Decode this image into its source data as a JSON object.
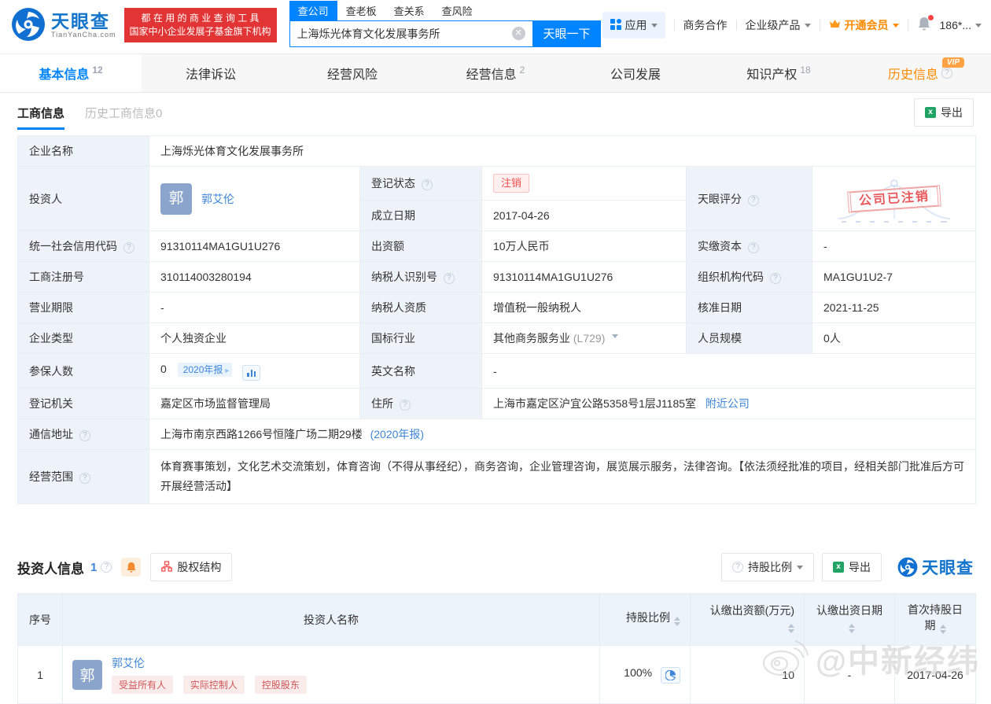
{
  "header": {
    "logo": {
      "name": "天眼查",
      "domain": "TianYanCha.com"
    },
    "promo": {
      "line1": "都 在 用 的 商 业 查 询 工 具",
      "line2": "国家中小企业发展子基金旗下机构"
    },
    "search": {
      "tabs": [
        {
          "label": "查公司"
        },
        {
          "label": "查老板"
        },
        {
          "label": "查关系"
        },
        {
          "label": "查风险"
        }
      ],
      "value": "上海烁光体育文化发展事务所",
      "button": "天眼一下"
    },
    "nav": {
      "apps": "应用",
      "bizcoop": "商务合作",
      "enterprise": "企业级产品",
      "vip": "开通会员",
      "phone": "186*..."
    }
  },
  "tabs": [
    {
      "label": "基本信息",
      "count": "12"
    },
    {
      "label": "法律诉讼",
      "count": ""
    },
    {
      "label": "经营风险",
      "count": ""
    },
    {
      "label": "经营信息",
      "count": "2"
    },
    {
      "label": "公司发展",
      "count": ""
    },
    {
      "label": "知识产权",
      "count": "18"
    },
    {
      "label": "历史信息",
      "count": "",
      "vip": "VIP"
    }
  ],
  "subtabs": {
    "active": "工商信息",
    "inactive": "历史工商信息0",
    "export": "导出"
  },
  "info": {
    "company_name": {
      "label": "企业名称",
      "value": "上海烁光体育文化发展事务所"
    },
    "investor": {
      "label": "投资人",
      "avatar": "郭",
      "name": "郭艾伦"
    },
    "reg_status": {
      "label": "登记状态",
      "value": "注销"
    },
    "establish_date": {
      "label": "成立日期",
      "value": "2017-04-26"
    },
    "score": {
      "label": "天眼评分",
      "stamp": "公司已注销"
    },
    "credit_code": {
      "label": "统一社会信用代码",
      "value": "91310114MA1GU1U276"
    },
    "contribution": {
      "label": "出资额",
      "value": "10万人民币"
    },
    "paid_capital": {
      "label": "实缴资本",
      "value": "-"
    },
    "reg_number": {
      "label": "工商注册号",
      "value": "310114003280194"
    },
    "taxpayer_id": {
      "label": "纳税人识别号",
      "value": "91310114MA1GU1U276"
    },
    "org_code": {
      "label": "组织机构代码",
      "value": "MA1GU1U2-7"
    },
    "business_term": {
      "label": "营业期限",
      "value": "-"
    },
    "taxpayer_quality": {
      "label": "纳税人资质",
      "value": "增值税一般纳税人"
    },
    "approval_date": {
      "label": "核准日期",
      "value": "2021-11-25"
    },
    "company_type": {
      "label": "企业类型",
      "value": "个人独资企业"
    },
    "industry": {
      "label": "国标行业",
      "value": "其他商务服务业",
      "code": "(L729)"
    },
    "staff_size": {
      "label": "人员规模",
      "value": "0人"
    },
    "insured": {
      "label": "参保人数",
      "value": "0",
      "badge": "2020年报"
    },
    "english_name": {
      "label": "英文名称",
      "value": "-"
    },
    "reg_authority": {
      "label": "登记机关",
      "value": "嘉定区市场监督管理局"
    },
    "address": {
      "label": "住所",
      "value": "上海市嘉定区沪宜公路5358号1层J1185室",
      "link": "附近公司"
    },
    "mailing_address": {
      "label": "通信地址",
      "value": "上海市南京西路1266号恒隆广场二期29楼",
      "link": "(2020年报)"
    },
    "business_scope": {
      "label": "经营范围",
      "value": "体育赛事策划，文化艺术交流策划，体育咨询（不得从事经纪），商务咨询，企业管理咨询，展览展示服务，法律咨询。【依法须经批准的项目，经相关部门批准后方可开展经营活动】"
    }
  },
  "investors": {
    "title": "投资人信息",
    "count": "1",
    "equity_button": "股权结构",
    "ratio_button": "持股比例",
    "export": "导出",
    "brand": "天眼查",
    "columns": [
      "序号",
      "投资人名称",
      "持股比例",
      "认缴出资额(万元)",
      "认缴出资日期",
      "首次持股日期"
    ],
    "rows": [
      {
        "index": "1",
        "avatar": "郭",
        "name": "郭艾伦",
        "tags": [
          "受益所有人",
          "实际控制人",
          "控股股东"
        ],
        "ratio": "100%",
        "amount": "10",
        "subscribe_date": "-",
        "first_date": "2017-04-26"
      }
    ]
  },
  "watermark": "@中新经纬",
  "colors": {
    "brand_blue": "#0084ff",
    "link_blue": "#3d86d8",
    "orange": "#ff8a00",
    "red": "#e64c4c",
    "label_bg": "#eef3f9"
  }
}
